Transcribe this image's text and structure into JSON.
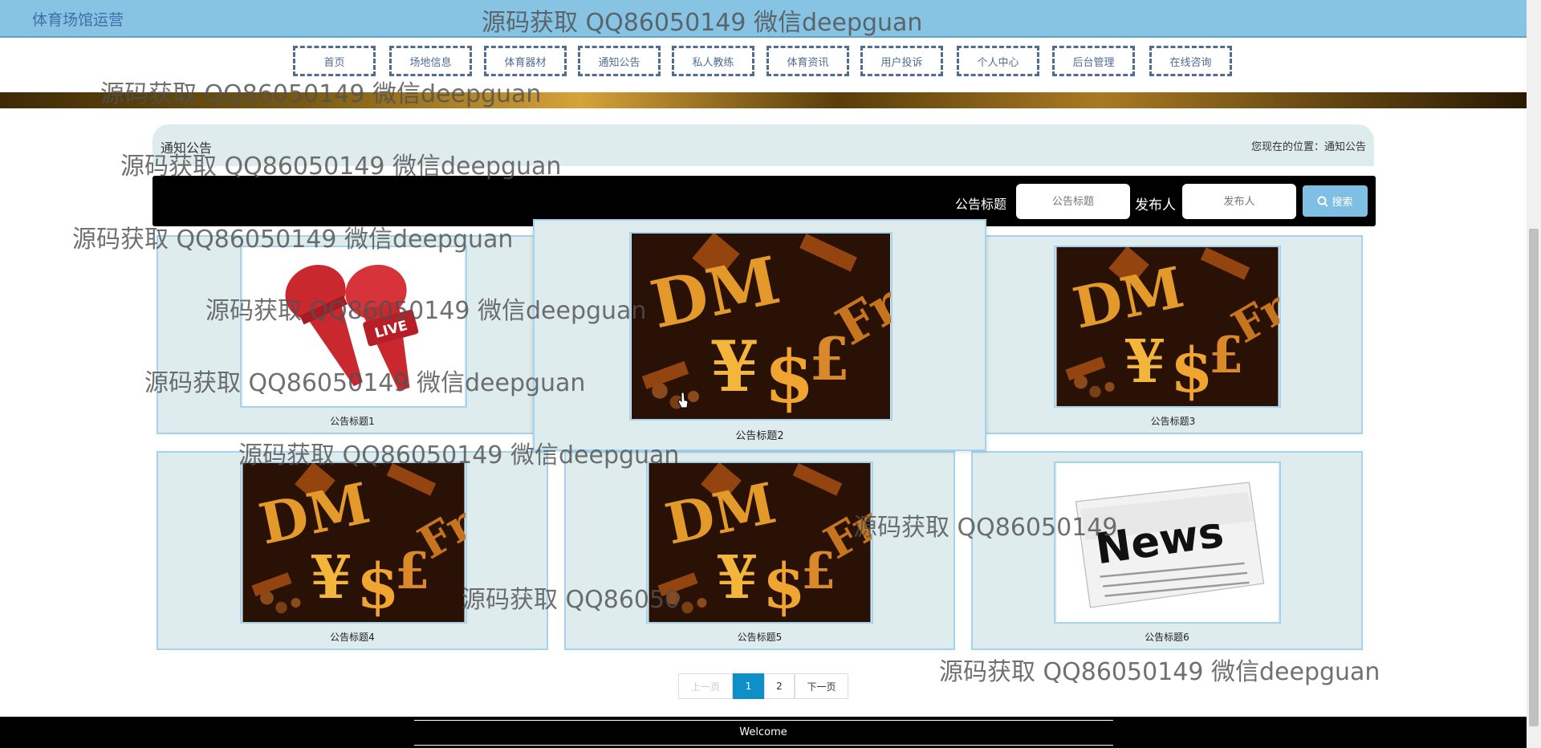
{
  "header": {
    "site_title": "体育场馆运营"
  },
  "watermark": "源码获取 QQ86050149 微信deepguan",
  "watermark_partial_1": "源码获取 QQ86050149",
  "watermark_partial_2": "源码获取 QQ86050",
  "nav": {
    "items": [
      "首页",
      "场地信息",
      "体育器材",
      "通知公告",
      "私人教练",
      "体育资讯",
      "用户投诉",
      "个人中心",
      "后台管理",
      "在线咨询"
    ]
  },
  "breadcrumb": {
    "title": "通知公告",
    "location": "您现在的位置：通知公告"
  },
  "search": {
    "title_label": "公告标题",
    "title_placeholder": "公告标题",
    "publisher_label": "发布人",
    "publisher_placeholder": "发布人",
    "button_label": "搜索"
  },
  "notices": [
    {
      "title": "公告标题1",
      "image": "live-microphones"
    },
    {
      "title": "公告标题2",
      "image": "currency-symbols"
    },
    {
      "title": "公告标题3",
      "image": "currency-symbols"
    },
    {
      "title": "公告标题4",
      "image": "currency-symbols"
    },
    {
      "title": "公告标题5",
      "image": "currency-symbols"
    },
    {
      "title": "公告标题6",
      "image": "news-paper"
    }
  ],
  "pagination": {
    "prev": "上一页",
    "pages": [
      "1",
      "2"
    ],
    "current": "1",
    "next": "下一页"
  },
  "footer": {
    "text": "Welcome"
  },
  "colors": {
    "topbar": "#87c4e3",
    "accent": "#0f8fc8",
    "card_bg": "#dfeced",
    "card_border": "#a5d3ee"
  }
}
